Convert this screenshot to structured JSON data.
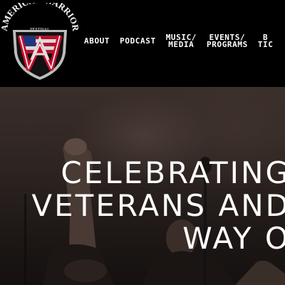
{
  "logo": {
    "top_text": "AMERICAN WARRIOR",
    "sub_text": "FESTIVAL",
    "colors": {
      "shield": "#111111",
      "border": "#bdbdbd",
      "red": "#c8102e",
      "blue": "#1f3c88"
    }
  },
  "nav": {
    "items": [
      {
        "lines": [
          "ABOUT"
        ]
      },
      {
        "lines": [
          "PODCAST"
        ]
      },
      {
        "lines": [
          "MUSIC/",
          "MEDIA"
        ]
      },
      {
        "lines": [
          "EVENTS/",
          "PROGRAMS"
        ]
      },
      {
        "lines": [
          "B",
          "TIC"
        ]
      }
    ]
  },
  "hero": {
    "lines": [
      "CELEBRATING",
      "VETERANS AND",
      "WAY O"
    ]
  }
}
